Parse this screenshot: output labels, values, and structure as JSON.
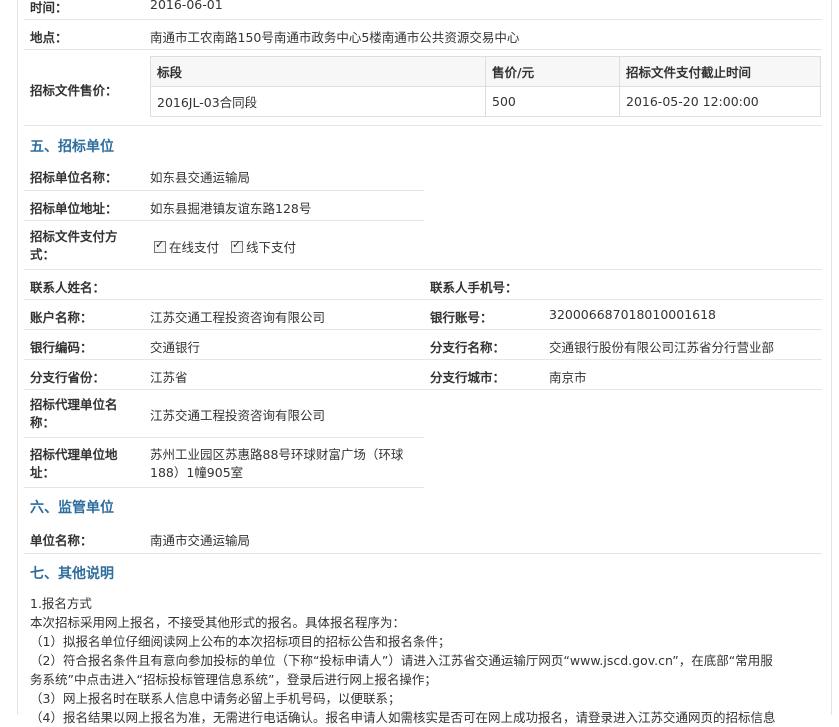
{
  "top": {
    "time_label": "时间：",
    "time_value": "2016-06-01",
    "place_label": "地点：",
    "place_value": "南通市工农南路150号南通市政务中心5楼南通市公共资源交易中心",
    "sale_label": "招标文件售价：",
    "sale_table": {
      "headers": [
        "标段",
        "售价/元",
        "招标文件支付截止时间"
      ],
      "rows": [
        [
          "2016JL-03合同段",
          "500",
          "2016-05-20 12:00:00"
        ]
      ]
    }
  },
  "section5": {
    "title": "五、招标单位",
    "name_label": "招标单位名称：",
    "name_value": "如东县交通运输局",
    "addr_label": "招标单位地址：",
    "addr_value": "如东县掘港镇友谊东路128号",
    "pay_label_1": "招标文件支付方",
    "pay_label_2": "式：",
    "pay_online": "在线支付",
    "pay_offline": "线下支付",
    "contact_label": "联系人姓名：",
    "contact_value": "",
    "phone_label": "联系人手机号：",
    "phone_value": "",
    "account_label": "账户名称：",
    "account_value": "江苏交通工程投资咨询有限公司",
    "bank_acct_label": "银行账号：",
    "bank_acct_value": "32000668701801000161​8",
    "bank_code_label": "银行编码：",
    "bank_code_value": "交通银行",
    "branch_label": "分支行名称：",
    "branch_value": "交通银行股份有限公司江苏省分行营业部",
    "prov_label": "分支行省份：",
    "prov_value": "江苏省",
    "city_label": "分支行城市：",
    "city_value": "南京市",
    "agent_name_label_1": "招标代理单位名",
    "agent_name_label_2": "称：",
    "agent_name_value": "江苏交通工程投资咨询有限公司",
    "agent_addr_label_1": "招标代理单位地",
    "agent_addr_label_2": "址：",
    "agent_addr_value_1": "苏州工业园区苏惠路88号环球财富广场（环球",
    "agent_addr_value_2": "188）1幢905室"
  },
  "section6": {
    "title": "六、监管单位",
    "unit_label": "单位名称：",
    "unit_value": "南通市交通运输局"
  },
  "section7": {
    "title": "七、其他说明",
    "lines": [
      "1.报名方式",
      "本次招标采用网上报名，不接受其他形式的报名。具体报名程序为：",
      "（1）拟报名单位仔细阅读网上公布的本次招标项目的招标公告和报名条件；",
      "（2）符合报名条件且有意向参加投标的单位（下称“投标申请人”）请进入江苏省交通运输厅网页“www.jscd.gov.cn”，在底部“常用服",
      "务系统”中点击进入“招标投标管理信息系统”，登录后进行网上报名操作；",
      "（3）网上报名时在联系人信息中请务必留上手机号码，以便联系；",
      "（4）报名结果以网上报名为准，无需进行电话确认。报名申请人如需核实是否可在网上成功报名，请登录进入江苏交通网页的招标信息"
    ]
  }
}
